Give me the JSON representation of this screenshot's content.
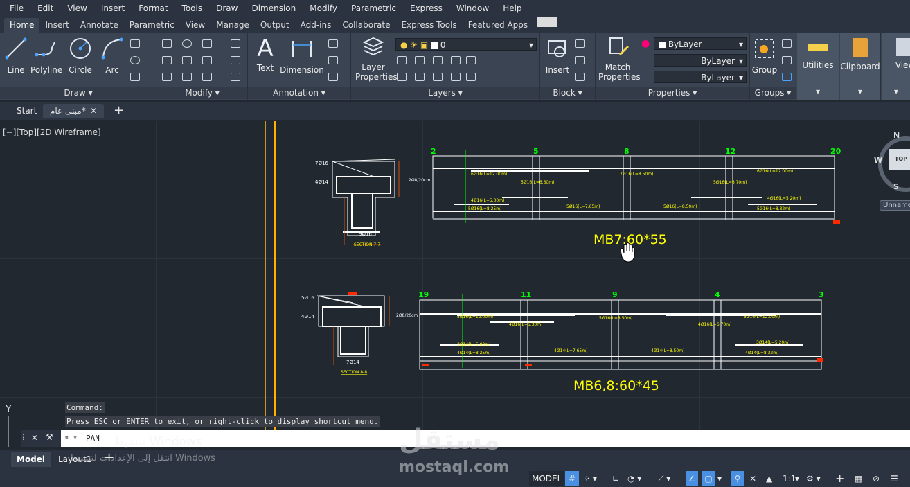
{
  "menu": [
    "File",
    "Edit",
    "View",
    "Insert",
    "Format",
    "Tools",
    "Draw",
    "Dimension",
    "Modify",
    "Parametric",
    "Express",
    "Window",
    "Help"
  ],
  "ribbon_tabs": [
    "Home",
    "Insert",
    "Annotate",
    "Parametric",
    "View",
    "Manage",
    "Output",
    "Add-ins",
    "Collaborate",
    "Express Tools",
    "Featured Apps"
  ],
  "active_tab": "Home",
  "draw": {
    "title": "Draw",
    "line": "Line",
    "polyline": "Polyline",
    "circle": "Circle",
    "arc": "Arc"
  },
  "modify": {
    "title": "Modify"
  },
  "annotation": {
    "title": "Annotation",
    "text": "Text",
    "dimension": "Dimension"
  },
  "layers": {
    "title": "Layers",
    "layer_properties": "Layer Properties",
    "current_layer": "0"
  },
  "block": {
    "title": "Block",
    "insert": "Insert"
  },
  "properties": {
    "title": "Properties",
    "match": "Match Properties",
    "color": "ByLayer",
    "linetype": "ByLayer",
    "lineweight": "ByLayer"
  },
  "groups": {
    "title": "Groups",
    "group": "Group"
  },
  "utilities": "Utilities",
  "clipboard": "Clipboard",
  "view": "View",
  "file_tabs": {
    "start": "Start",
    "doc": "مبنى عام*"
  },
  "viewport_label": "[−][Top][2D Wireframe]",
  "viewcube": {
    "n": "N",
    "s": "S",
    "w": "W",
    "top": "TOP",
    "unnamed": "Unnamed"
  },
  "drawing": {
    "beam1": {
      "title": "MB7:60*55",
      "section": "SECTION 7-7",
      "top_bars": "7Ø16",
      "mid_bars": "4Ø14",
      "bottom_bars": "9Ø16",
      "stirrup": "2Ø8/20cm",
      "axes": [
        "2",
        "5",
        "8",
        "12",
        "20"
      ],
      "rebar": [
        "6Ø16(L=12.00m)",
        "5Ø16(L=6.30m)",
        "7Ø16(L=8.50m)",
        "5Ø16(L=6.70m)",
        "6Ø16(L=12.00m)",
        "4Ø16(L=5.00m)",
        "5Ø16(L=8.25m)",
        "5Ø16(L=7.65m)",
        "5Ø16(L=8.50m)",
        "4Ø16(L=5.20m)",
        "5Ø16(L=8.32m)"
      ]
    },
    "beam2": {
      "title": "MB6,8:60*45",
      "section": "SECTION 8-8",
      "top_bars": "5Ø16",
      "mid_bars": "4Ø14",
      "bottom_bars": "7Ø14",
      "stirrup": "2Ø8/20cm",
      "axes": [
        "19",
        "11",
        "9",
        "4",
        "3"
      ],
      "rebar": [
        "5Ø16(L=12.00m)",
        "4Ø16(L=6.30m)",
        "5Ø16(L=8.50m)",
        "4Ø16(L=6.70m)",
        "5Ø16(L=12.00m)",
        "3Ø14(L=5.00m)",
        "4Ø14(L=8.25m)",
        "4Ø14(L=7.65m)",
        "4Ø14(L=8.50m)",
        "3Ø14(L=5.20m)",
        "4Ø14(L=8.32m)"
      ]
    }
  },
  "command": {
    "history1": "Command:",
    "history2": "Press ESC or ENTER to exit, or right-click to display shortcut menu.",
    "current": "PAN"
  },
  "watermark": {
    "activate": "تنشيط Windows",
    "goto": "انتقل إلى الإعدادات لتنشيط Windows",
    "brand_ar": "مستقل",
    "brand_en": "mostaql.com"
  },
  "layout_tabs": {
    "model": "Model",
    "layout1": "Layout1"
  },
  "status": {
    "model": "MODEL",
    "scale": "1:1"
  },
  "colors": {
    "accent": "#1e90ff",
    "yellow_text": "#ffff00",
    "axis_green": "#00ff00",
    "red": "#ff2a00",
    "orange_line": "#ffb000"
  }
}
